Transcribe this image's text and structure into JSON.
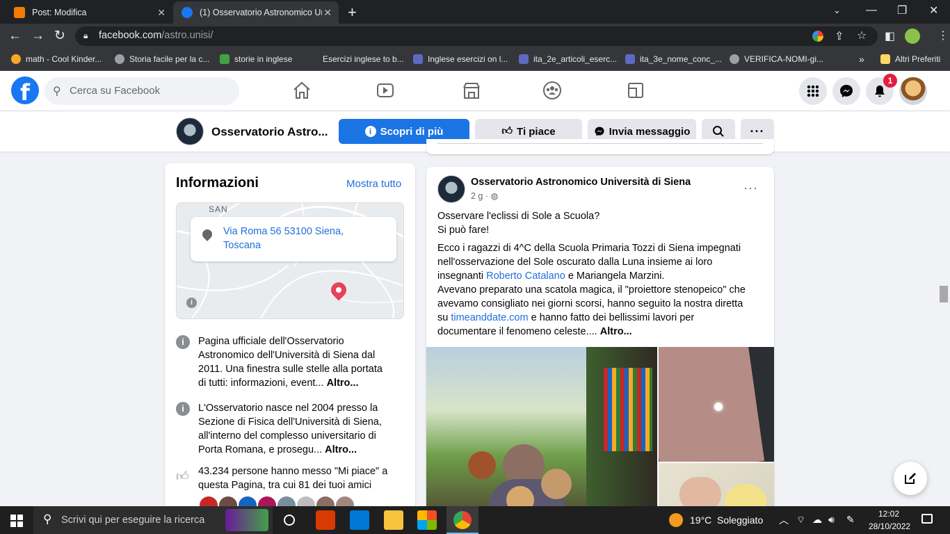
{
  "browser": {
    "tabs": [
      {
        "title": "Post: Modifica",
        "favicon_color": "#f57c00"
      },
      {
        "title": "(1) Osservatorio Astronomico Un",
        "favicon_color": "#1877f2"
      }
    ],
    "address": {
      "domain": "facebook.com",
      "path": "/astro.unisi/"
    },
    "bookmarks": [
      {
        "label": "math - Cool Kinder..."
      },
      {
        "label": "Storia facile per la c..."
      },
      {
        "label": "storie in inglese"
      },
      {
        "label": "Esercizi inglese to b..."
      },
      {
        "label": "Inglese esercizi on l..."
      },
      {
        "label": "ita_2e_articoli_eserc..."
      },
      {
        "label": "ita_3e_nome_conc_..."
      },
      {
        "label": "VERIFICA-NOMI-gi..."
      }
    ],
    "bookmarks_more": "»",
    "other_bookmarks": "Altri Preferiti"
  },
  "fb": {
    "logo": "f",
    "search_placeholder": "Cerca su Facebook",
    "notification_count": "1",
    "accent": "#1877f2"
  },
  "page": {
    "name": "Osservatorio Astro...",
    "learn_more": "Scopri di più",
    "like": "Ti piace",
    "message": "Invia messaggio"
  },
  "info": {
    "title": "Informazioni",
    "show_all": "Mostra tutto",
    "map_label": "SAN",
    "address_line1": "Via Roma 56 53100 Siena,",
    "address_line2": "Toscana",
    "desc1": [
      "Pagina ufficiale dell'Osservatorio",
      "Astronomico dell'Università di Siena dal",
      "2011. Una finestra sulle stelle alla portata",
      "di tutti: informazioni, event..."
    ],
    "desc2": [
      "L'Osservatorio nasce nel 2004 presso la",
      "Sezione di Fisica dell'Università di Siena,",
      "all'interno del complesso universitario di",
      "Porta Romana, e prosegu..."
    ],
    "more": "Altro...",
    "likes": [
      "43.234 persone hanno messo \"Mi piace\" a",
      "questa Pagina, tra cui 81 dei tuoi amici"
    ]
  },
  "post": {
    "author": "Osservatorio Astronomico Università di Siena",
    "time": "2 g",
    "time_sep": "·",
    "line1": "Osservare l'eclissi di Sole a Scuola?",
    "line2": "Si può fare!",
    "p1": "Ecco i ragazzi di 4^C della Scuola Primaria Tozzi di Siena impegnati",
    "p2": "nell'osservazione del Sole oscurato dalla Luna insieme ai loro",
    "p3_pre": "insegnanti ",
    "p3_link": "Roberto Catalano",
    "p3_post": " e Mariangela Marzini.",
    "p4": "Avevano preparato una scatola magica, il \"proiettore stenopeico\" che",
    "p5": "avevamo consigliato nei giorni scorsi, hanno seguito la nostra diretta",
    "p6_pre": "su ",
    "p6_link": "timeanddate.com",
    "p6_post": " e hanno fatto dei bellissimi lavori per",
    "p7": "documentare il fenomeno celeste.... ",
    "p7_more": "Altro..."
  },
  "taskbar": {
    "search_placeholder": "Scrivi qui per eseguire la ricerca",
    "weather": "19°C  Soleggiato",
    "time": "12:02",
    "date": "28/10/2022"
  }
}
